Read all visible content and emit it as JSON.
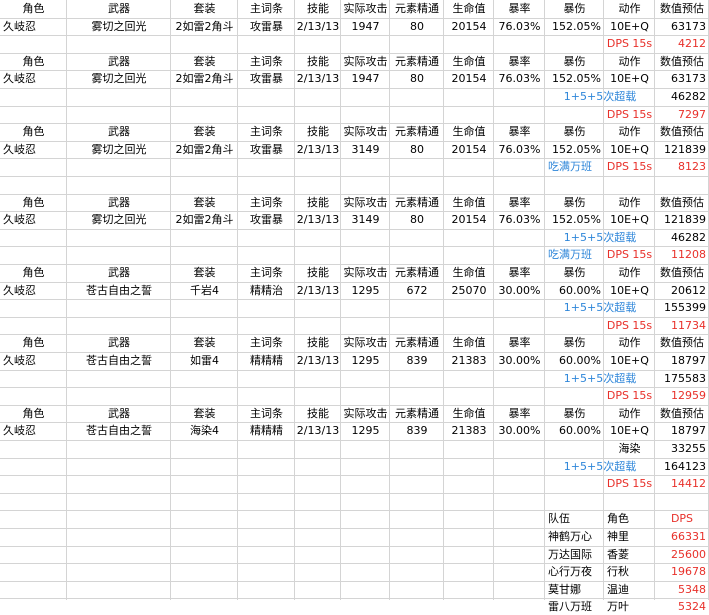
{
  "colors": {
    "red": "#e8302a",
    "blue": "#2e86d9",
    "grid": "#d4d4d4"
  },
  "headers": [
    "角色",
    "武器",
    "套装",
    "主词条",
    "技能",
    "实际攻击",
    "元素精通",
    "生命值",
    "暴率",
    "暴伤",
    "动作",
    "数值预估"
  ],
  "blocks": [
    {
      "values": [
        "久岐忍",
        "雾切之回光",
        "2如雷2角斗",
        "攻雷暴",
        "2/13/13",
        "1947",
        "80",
        "20154",
        "76.03%",
        "152.05%",
        "10E+Q",
        "63173"
      ],
      "extras": [
        {
          "label": "DPS  15s",
          "value": "4212",
          "label_color": "red",
          "value_color": "red"
        }
      ]
    },
    {
      "values": [
        "久岐忍",
        "雾切之回光",
        "2如雷2角斗",
        "攻雷暴",
        "2/13/13",
        "1947",
        "80",
        "20154",
        "76.03%",
        "152.05%",
        "10E+Q",
        "63173"
      ],
      "extras": [
        {
          "label": "1+5+5次超载",
          "value": "46282",
          "label_color": "blue",
          "value_color": ""
        },
        {
          "label": "DPS  15s",
          "value": "7297",
          "label_color": "red",
          "value_color": "red"
        }
      ]
    },
    {
      "values": [
        "久岐忍",
        "雾切之回光",
        "2如雷2角斗",
        "攻雷暴",
        "2/13/13",
        "3149",
        "80",
        "20154",
        "76.03%",
        "152.05%",
        "10E+Q",
        "121839"
      ],
      "extras": [
        {
          "label": "吃满万班",
          "value": "",
          "label_color": "blue",
          "value_color": "",
          "wide": true,
          "label2": "DPS  15s",
          "value2": "8123"
        }
      ]
    },
    {
      "values": [
        "久岐忍",
        "雾切之回光",
        "2如雷2角斗",
        "攻雷暴",
        "2/13/13",
        "3149",
        "80",
        "20154",
        "76.03%",
        "152.05%",
        "10E+Q",
        "121839"
      ],
      "extras": [
        {
          "label": "1+5+5次超载",
          "value": "46282",
          "label_color": "blue",
          "value_color": ""
        },
        {
          "label": "吃满万班",
          "value": "",
          "label_color": "blue",
          "value_color": "",
          "wide": true,
          "label2": "DPS  15s",
          "value2": "11208"
        }
      ]
    },
    {
      "values": [
        "久岐忍",
        "苍古自由之誓",
        "千岩4",
        "精精治",
        "2/13/13",
        "1295",
        "672",
        "25070",
        "30.00%",
        "60.00%",
        "10E+Q",
        "20612"
      ],
      "extras": [
        {
          "label": "1+5+5次超载",
          "value": "155399",
          "label_color": "blue",
          "value_color": ""
        },
        {
          "label": "DPS  15s",
          "value": "11734",
          "label_color": "red",
          "value_color": "red"
        }
      ]
    },
    {
      "values": [
        "久岐忍",
        "苍古自由之誓",
        "如雷4",
        "精精精",
        "2/13/13",
        "1295",
        "839",
        "21383",
        "30.00%",
        "60.00%",
        "10E+Q",
        "18797"
      ],
      "extras": [
        {
          "label": "1+5+5次超载",
          "value": "175583",
          "label_color": "blue",
          "value_color": ""
        },
        {
          "label": "DPS  15s",
          "value": "12959",
          "label_color": "red",
          "value_color": "red"
        }
      ]
    },
    {
      "values": [
        "久岐忍",
        "苍古自由之誓",
        "海染4",
        "精精精",
        "2/13/13",
        "1295",
        "839",
        "21383",
        "30.00%",
        "60.00%",
        "10E+Q",
        "18797"
      ],
      "extras": [
        {
          "label": "海染",
          "value": "33255",
          "label_color": "",
          "value_color": ""
        },
        {
          "label": "1+5+5次超载",
          "value": "164123",
          "label_color": "blue",
          "value_color": ""
        },
        {
          "label": "DPS  15s",
          "value": "14412",
          "label_color": "red",
          "value_color": "red"
        }
      ]
    }
  ],
  "summary": {
    "headers": [
      "队伍",
      "角色",
      "DPS"
    ],
    "rows": [
      [
        "神鹤万心",
        "神里",
        "66331"
      ],
      [
        "万达国际",
        "香菱",
        "25600"
      ],
      [
        "心行万夜",
        "行秋",
        "19678"
      ],
      [
        "莫甘娜",
        "温迪",
        "5348"
      ],
      [
        "雷八万班",
        "万叶",
        "5324"
      ]
    ]
  }
}
